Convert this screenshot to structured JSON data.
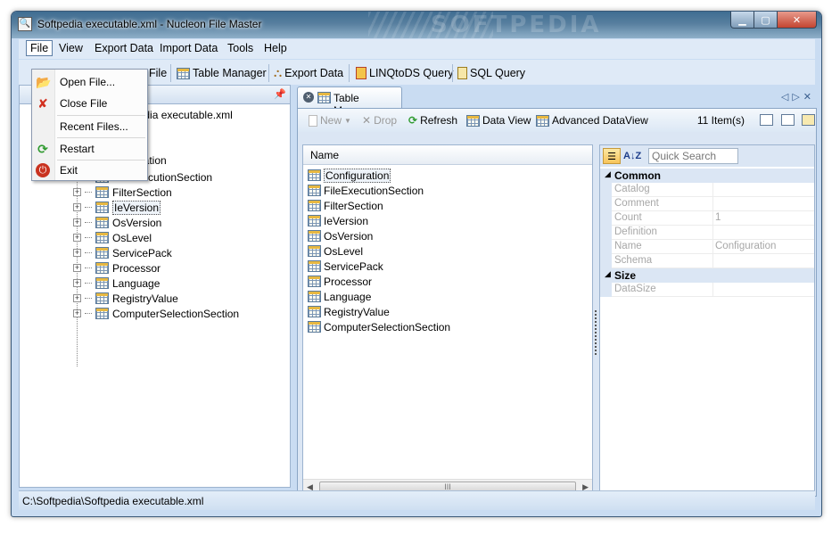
{
  "window": {
    "title": "Softpedia executable.xml - Nucleon File Master",
    "watermark": "SOFTPEDIA"
  },
  "menubar": {
    "items": [
      "File",
      "View",
      "Export Data",
      "Import Data",
      "Tools",
      "Help"
    ]
  },
  "toolbar": {
    "buttons": [
      {
        "label": "File",
        "icon": "close-file-icon"
      },
      {
        "label": "Table Manager",
        "icon": "table-icon"
      },
      {
        "label": "Export Data",
        "icon": "export-icon"
      },
      {
        "label": "LINQtoDS Query",
        "icon": "linq-icon"
      },
      {
        "label": "SQL Query",
        "icon": "sql-icon"
      }
    ]
  },
  "file_menu": {
    "items": [
      {
        "label": "Open File...",
        "icon": "open-folder-icon"
      },
      {
        "label": "Close File",
        "icon": "red-x-icon"
      },
      {
        "label": "Recent Files...",
        "icon": ""
      },
      {
        "label": "Restart",
        "icon": "refresh-icon"
      },
      {
        "label": "Exit",
        "icon": "power-icon"
      }
    ]
  },
  "tree": {
    "root_label": "pedia executable.xml",
    "partial_item": "uration",
    "items": [
      "FileExecutionSection",
      "FilterSection",
      "IeVersion",
      "OsVersion",
      "OsLevel",
      "ServicePack",
      "Processor",
      "Language",
      "RegistryValue",
      "ComputerSelectionSection"
    ],
    "selected_index": 2
  },
  "tab": {
    "label": "Table Manager"
  },
  "content_toolbar": {
    "new_label": "New",
    "drop_label": "Drop",
    "refresh_label": "Refresh",
    "data_view_label": "Data View",
    "advanced_view_label": "Advanced DataView",
    "item_count": "11 Item(s)"
  },
  "table_list": {
    "header": "Name",
    "rows": [
      "Configuration",
      "FileExecutionSection",
      "FilterSection",
      "IeVersion",
      "OsVersion",
      "OsLevel",
      "ServicePack",
      "Processor",
      "Language",
      "RegistryValue",
      "ComputerSelectionSection"
    ],
    "selected_index": 0,
    "scroll_thumb_label": "III"
  },
  "properties": {
    "search_placeholder": "Quick Search",
    "sort_label": "A↓Z",
    "categories": [
      {
        "name": "Common",
        "rows": [
          {
            "name": "Catalog",
            "value": ""
          },
          {
            "name": "Comment",
            "value": ""
          },
          {
            "name": "Count",
            "value": "1"
          },
          {
            "name": "Definition",
            "value": ""
          },
          {
            "name": "Name",
            "value": "Configuration"
          },
          {
            "name": "Schema",
            "value": ""
          }
        ]
      },
      {
        "name": "Size",
        "rows": [
          {
            "name": "DataSize",
            "value": ""
          }
        ]
      }
    ]
  },
  "statusbar": {
    "path": "C:\\Softpedia\\Softpedia executable.xml"
  },
  "colors": {
    "window_frame": "#c9dcf2",
    "accent_blue": "#3a5877",
    "close_red": "#c34430"
  }
}
